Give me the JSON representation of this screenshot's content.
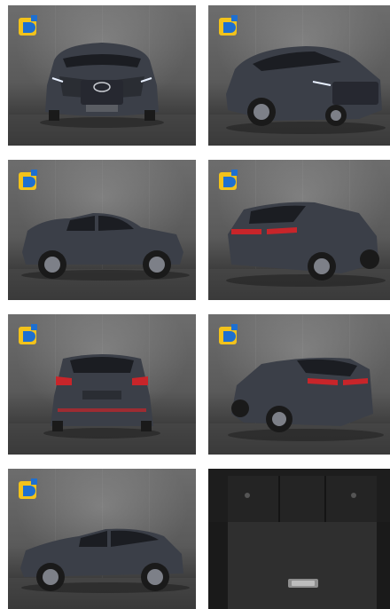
{
  "gallery": {
    "images": [
      {
        "view": "front"
      },
      {
        "view": "front-three-quarter"
      },
      {
        "view": "side-left"
      },
      {
        "view": "rear-three-quarter-right"
      },
      {
        "view": "rear"
      },
      {
        "view": "rear-three-quarter-left"
      },
      {
        "view": "side-left-low"
      },
      {
        "view": "trunk-interior"
      }
    ]
  },
  "colors": {
    "car_body": "#3b3f48",
    "studio_wall": "#6b6b6b",
    "studio_floor": "#3f3f3f",
    "logo_yellow": "#f2c21b",
    "logo_blue": "#1e6fd0",
    "tail_light": "#c8252a",
    "head_light": "#e8f0ff"
  },
  "icons": {
    "logo": "dealer-logo-icon"
  }
}
